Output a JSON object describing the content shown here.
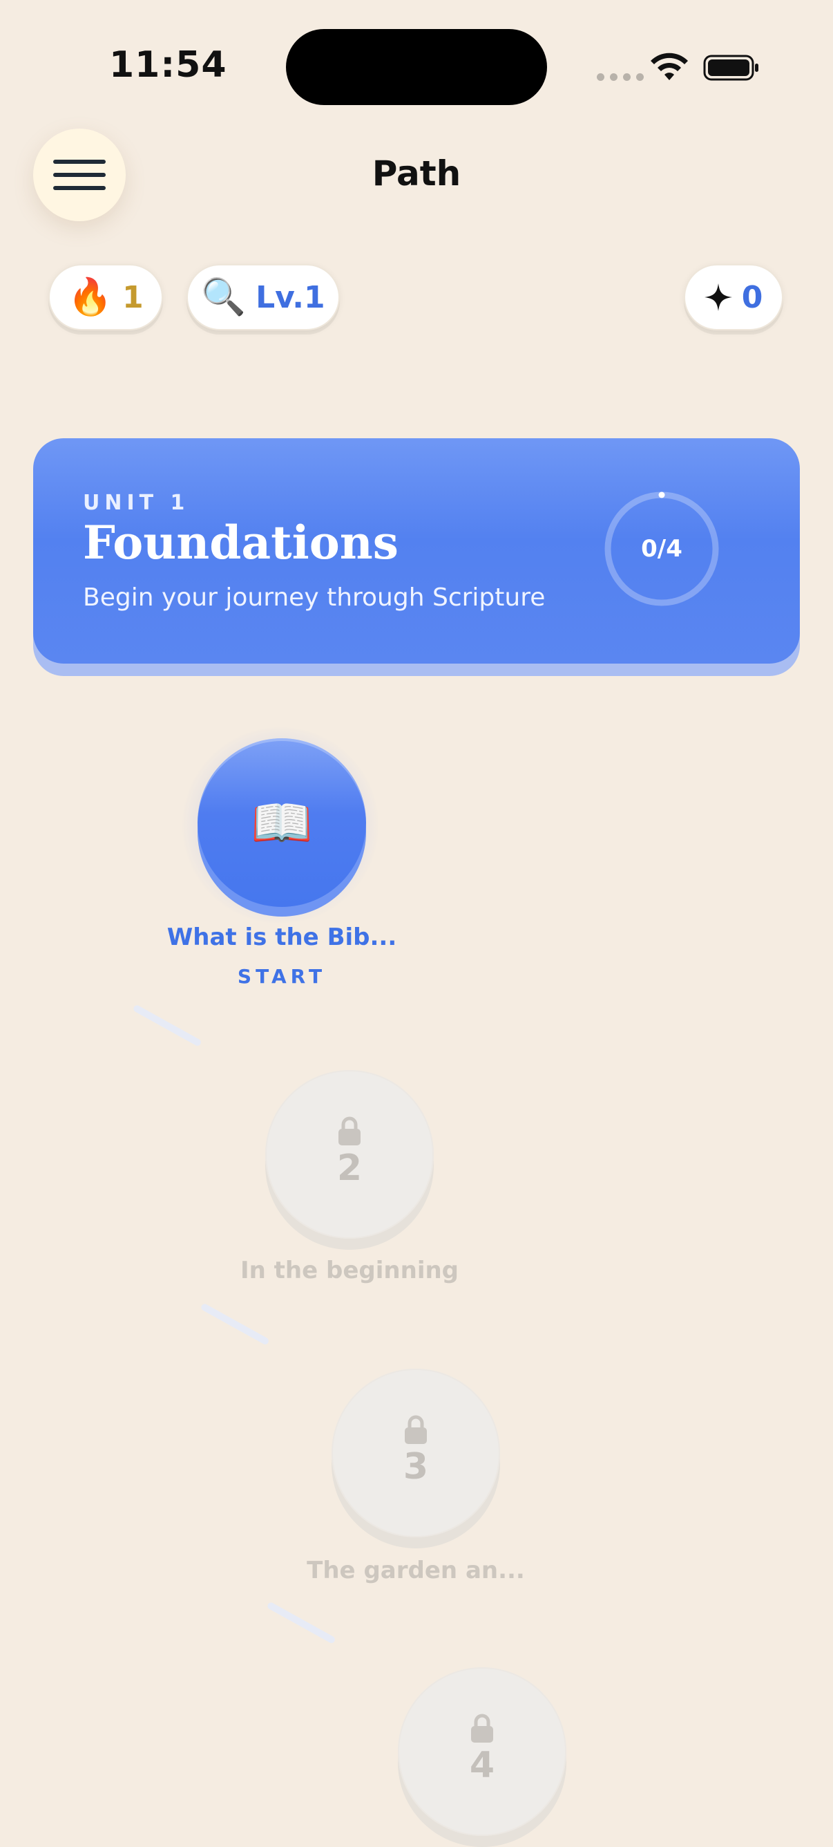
{
  "status_bar": {
    "time": "11:54"
  },
  "header": {
    "title": "Path",
    "menu_icon": "hamburger-menu-icon"
  },
  "stats": {
    "streak": {
      "icon": "🔥",
      "value": "1"
    },
    "level": {
      "icon": "🔍",
      "value": "Lv.1"
    },
    "gems": {
      "icon": "sparkle-icon",
      "value": "0"
    }
  },
  "unit": {
    "kicker": "UNIT 1",
    "title": "Foundations",
    "subtitle": "Begin your journey through Scripture",
    "progress_text": "0/4",
    "progress_fraction": 0,
    "color": "#5381F0"
  },
  "lessons": [
    {
      "icon": "📖",
      "label": "What is the Bib...",
      "action": "START",
      "state": "active"
    },
    {
      "number": "2",
      "label": "In the beginning",
      "state": "locked",
      "icon": "lock-icon"
    },
    {
      "number": "3",
      "label": "The garden an...",
      "state": "locked",
      "icon": "lock-icon"
    },
    {
      "number": "4",
      "label": "",
      "state": "locked",
      "icon": "lock-icon"
    }
  ],
  "colors": {
    "background": "#F5ECE1",
    "accent": "#3F72E6",
    "streak": "#C59A2E"
  }
}
